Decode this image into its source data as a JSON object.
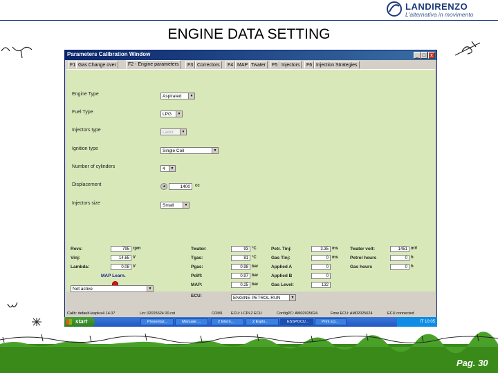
{
  "brand": {
    "name": "LANDIRENZO",
    "tagline": "L'alternativa in movimento"
  },
  "page": {
    "title": "ENGINE DATA SETTING",
    "page_number": "Pag. 30"
  },
  "window": {
    "title": "Parameters Calibration Window",
    "controls": {
      "minimize": "_",
      "maximize": "□",
      "close": "x"
    }
  },
  "tabs": [
    {
      "label": "F1"
    },
    {
      "label": "Gas Change over"
    },
    {
      "label": "F2 - Engine parameters"
    },
    {
      "label": "F3"
    },
    {
      "label": "Correctors"
    },
    {
      "label": "F4"
    },
    {
      "label": "MAP"
    },
    {
      "label": "Twater"
    },
    {
      "label": "F5"
    },
    {
      "label": "Injectors"
    },
    {
      "label": "F6"
    },
    {
      "label": "Injection Strategies"
    }
  ],
  "engine": {
    "engine_type": {
      "label": "Engine Type",
      "value": "Aspirated"
    },
    "fuel_type": {
      "label": "Fuel Type",
      "value": "LPG"
    },
    "injectors_type": {
      "label": "Injectors type",
      "value": "Lanci"
    },
    "ignition_type": {
      "label": "Ignition type",
      "value": "Single Coil"
    },
    "cylinders": {
      "label": "Number of cylinders",
      "value": "4"
    },
    "displacement": {
      "label": "Displacement",
      "value": "1400",
      "unit": "cc"
    },
    "injectors_size": {
      "label": "Injectors size",
      "value": "Small"
    }
  },
  "monitor": {
    "col1": [
      {
        "label": "Revs:",
        "value": "795",
        "unit": "rpm"
      },
      {
        "label": "Vinj:",
        "value": "14.65",
        "unit": "V"
      },
      {
        "label": "Lambda:",
        "value": "0.08",
        "unit": "V"
      }
    ],
    "map_learn_label": "MAP Learn.",
    "map_learn_select": "Not active",
    "col2": [
      {
        "label": "Twater:",
        "value": "93",
        "unit": "°C"
      },
      {
        "label": "Tgas:",
        "value": "81",
        "unit": "°C"
      },
      {
        "label": "Pgas:",
        "value": "0.98",
        "unit": "bar"
      },
      {
        "label": "Pdiff:",
        "value": "0.97",
        "unit": "bar"
      },
      {
        "label": "MAP:",
        "value": "0.25",
        "unit": "bar"
      }
    ],
    "ecu_label": "ECU:",
    "ecu_value": "ENGINE PETROL RUN",
    "col3": [
      {
        "label": "Petr. Tinj:",
        "value": "3.35",
        "unit": "ms"
      },
      {
        "label": "Gas Tinj:",
        "value": "0",
        "unit": "ms"
      },
      {
        "label": "Applied A",
        "value": "0",
        "unit": ""
      },
      {
        "label": "Applied B",
        "value": "0",
        "unit": ""
      },
      {
        "label": "Gas Level:",
        "value": "132",
        "unit": ""
      }
    ],
    "col4": [
      {
        "label": "Twater volt:",
        "value": "1451",
        "unit": "mV"
      },
      {
        "label": "Petrol hours",
        "value": "0",
        "unit": "h"
      },
      {
        "label": "Gas hours",
        "value": "0",
        "unit": "h"
      }
    ]
  },
  "status_bar": {
    "calib": "Calib: default-lasplus4 14.07",
    "file": "Lin: 02025624 00.cst",
    "port": "COM1",
    "ecu": "ECU: LCPL2 ECU",
    "config": "ConfigPC: AM02025624",
    "fmw": "Fmw ECU: AM02025624",
    "conn": "ECU connected"
  },
  "taskbar": {
    "start": "start",
    "items": [
      "Presentaz...",
      "Manuale ...",
      "2 Intern...",
      "2 Esplo...",
      "ESSPOCU...",
      "Print scr..."
    ],
    "tray": "IT 10:05"
  },
  "colors": {
    "panel": "#d9e8b9",
    "titlebar": "#0a246a",
    "taskbar": "#2457c5",
    "footer": "#3a8a1a"
  }
}
